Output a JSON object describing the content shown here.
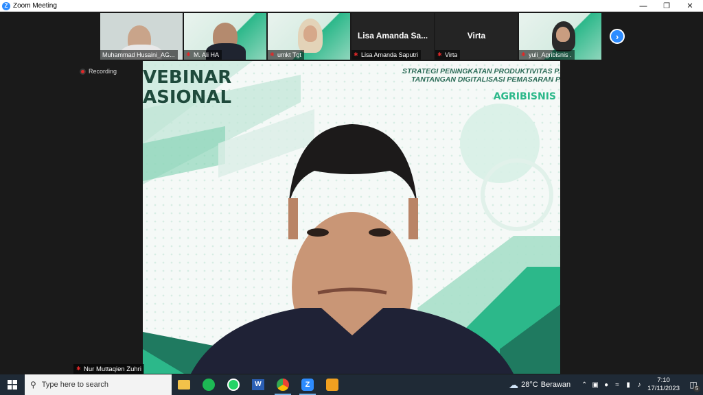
{
  "window": {
    "title": "Zoom Meeting"
  },
  "participants": [
    {
      "name": "Muhammad Husaini_AG...",
      "type": "video"
    },
    {
      "name": "M. Ali HA",
      "type": "video"
    },
    {
      "name": "umkt Tgt",
      "type": "video"
    },
    {
      "name": "Lisa Amanda Saputri",
      "display": "Lisa Amanda Sa...",
      "type": "name"
    },
    {
      "name": "Virta",
      "display": "Virta",
      "type": "name"
    },
    {
      "name": "yuli_Agribisnis .",
      "type": "video"
    }
  ],
  "recording": {
    "label": "Recording"
  },
  "speaker": {
    "name": "Nur Muttaqien Zuhri"
  },
  "banner": {
    "title_line1": "VEBINAR",
    "title_line2": "ASIONAL",
    "strategy_line1": "STRATEGI PENINGKATAN PRODUKTIVITAS  P.",
    "strategy_line2": "TANTANGAN DIGITALISASI PEMASARAN P",
    "brand": "AGRIBISNIS"
  },
  "taskbar": {
    "search_placeholder": "Type here to search",
    "weather_temp": "28°C",
    "weather_text": "Berawan",
    "time": "7:10",
    "date": "17/11/2023",
    "notifications": "5"
  },
  "colors": {
    "zoom_blue": "#2d8cff",
    "recording_red": "#e02828",
    "banner_green": "#2cb88a"
  }
}
